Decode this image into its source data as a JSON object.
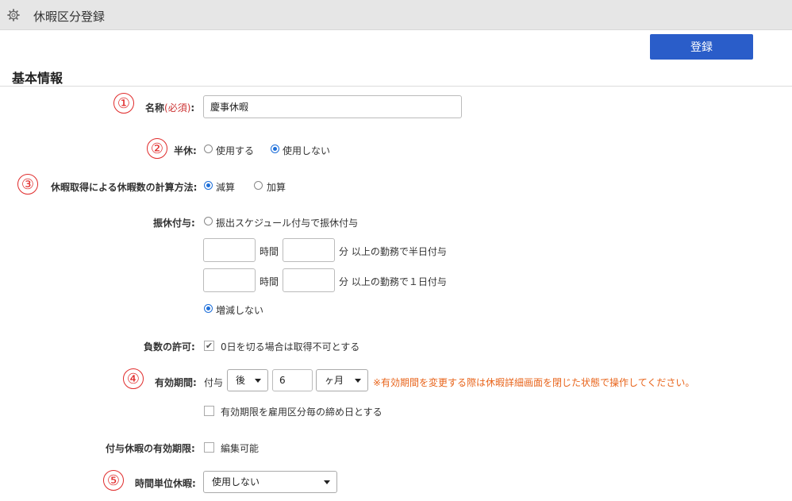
{
  "header": {
    "title": "休暇区分登録",
    "icon": "gear-icon"
  },
  "toolbar": {
    "register_label": "登録"
  },
  "section": {
    "title": "基本情報"
  },
  "markers": [
    "①",
    "②",
    "③",
    "④",
    "⑤"
  ],
  "form": {
    "name": {
      "label": "名称",
      "required": "(必須)",
      "colon": ":",
      "value": "慶事休暇"
    },
    "half": {
      "label": "半休:",
      "opt_use": "使用する",
      "opt_nouse": "使用しない"
    },
    "calc": {
      "label": "休暇取得による休暇数の計算方法:",
      "opt_sub": "減算",
      "opt_add": "加算"
    },
    "transfer": {
      "label": "振休付与:",
      "opt_schedule": "振出スケジュール付与で振休付与",
      "hours_unit": "時間",
      "min_unit_half": "分 以上の勤務で半日付与",
      "min_unit_full": "分 以上の勤務で１日付与",
      "opt_none": "増減しない"
    },
    "negative": {
      "label": "負数の許可:",
      "check_label": "0日を切る場合は取得不可とする"
    },
    "validity": {
      "label": "有効期間:",
      "prefix": "付与",
      "after_value": "後",
      "count_value": "6",
      "unit_value": "ヶ月",
      "note": "※有効期間を変更する際は休暇詳細画面を閉じた状態で操作してください。",
      "closing_label": "有効期限を雇用区分毎の締め日とする"
    },
    "grant_validity": {
      "label": "付与休暇の有効期限:",
      "check_label": "編集可能"
    },
    "hourly": {
      "label": "時間単位休暇:",
      "value": "使用しない"
    }
  }
}
